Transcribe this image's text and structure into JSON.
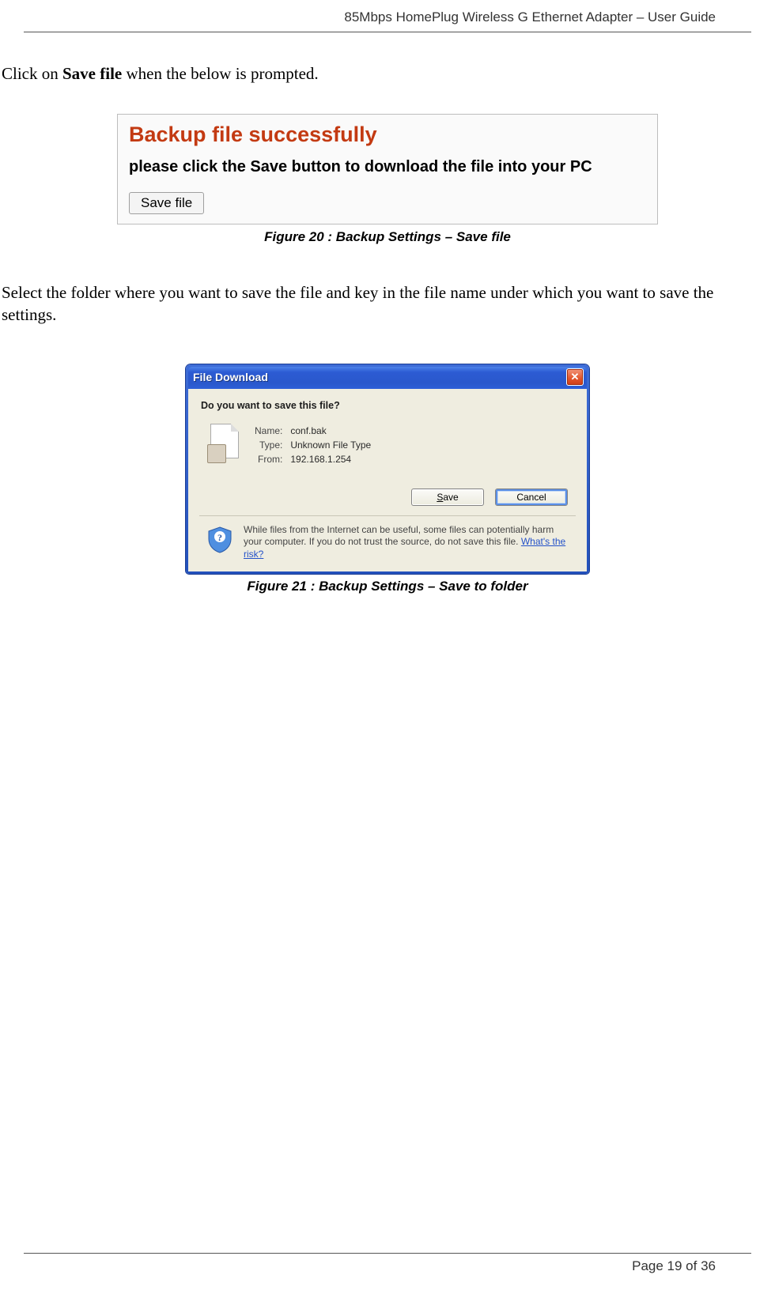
{
  "header": {
    "title": "85Mbps HomePlug Wireless G Ethernet Adapter – User Guide"
  },
  "intro": {
    "line1_prefix": "Click on ",
    "line1_bold": "Save file",
    "line1_suffix": " when the below is prompted.",
    "line2": "Select the folder where you want to save the file and key in the file name under which you want to save the settings."
  },
  "figure20": {
    "panel_title": "Backup file successfully",
    "panel_subtitle": "please click the Save button to download the file into your PC",
    "button_label": "Save file",
    "caption": "Figure 20 : Backup Settings – Save file"
  },
  "figure21": {
    "dialog_title": "File Download",
    "prompt": "Do you want to save this file?",
    "info": {
      "name_label": "Name:",
      "name_value": "conf.bak",
      "type_label": "Type:",
      "type_value": "Unknown File Type",
      "from_label": "From:",
      "from_value": "192.168.1.254"
    },
    "save_button": "Save",
    "cancel_button": "Cancel",
    "warning_text": "While files from the Internet can be useful, some files can potentially harm your computer. If you do not trust the source, do not save this file. ",
    "warning_link": "What's the risk?",
    "caption": "Figure 21 : Backup Settings – Save to folder"
  },
  "footer": {
    "page": "Page 19 of 36"
  }
}
